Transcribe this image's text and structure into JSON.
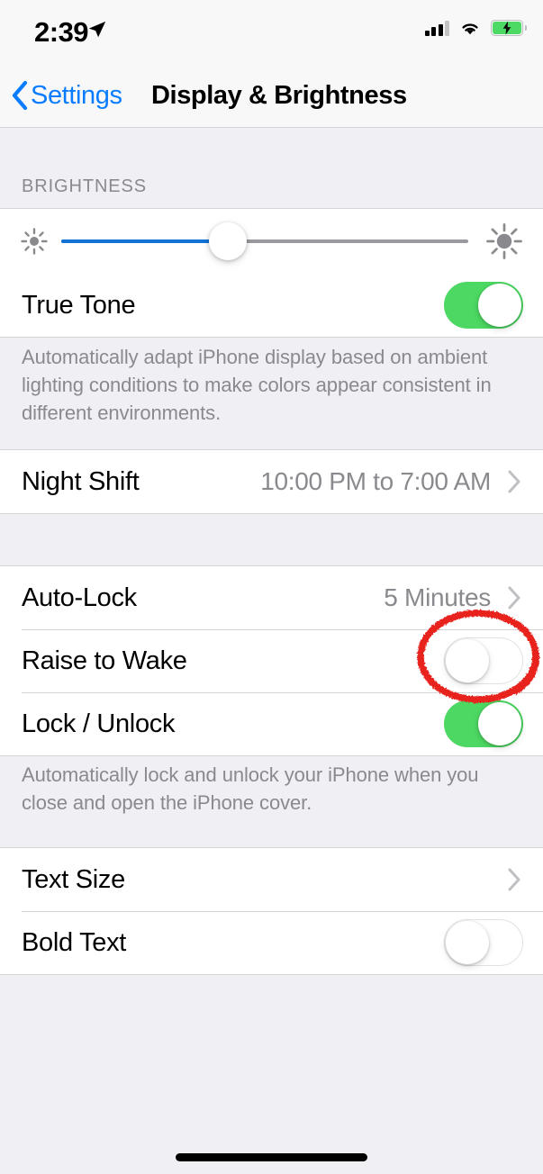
{
  "status_bar": {
    "time": "2:39",
    "location_icon": "location-arrow-icon",
    "signal_icon": "cellular-signal-icon",
    "signal_bars_filled": 3,
    "signal_bars_total": 4,
    "wifi_icon": "wifi-icon",
    "battery_icon": "battery-charging-icon",
    "battery_charging": true,
    "battery_color": "#4CD964"
  },
  "nav_bar": {
    "back_icon": "chevron-left-icon",
    "back_label": "Settings",
    "title": "Display & Brightness",
    "tint_color": "#0A7CFF"
  },
  "brightness": {
    "header": "BRIGHTNESS",
    "slider": {
      "name": "brightness-slider",
      "value_percent": 41,
      "min_icon": "sun-dim-icon",
      "max_icon": "sun-bright-icon",
      "fill_color": "#1272D6"
    },
    "true_tone": {
      "label": "True Tone",
      "toggle_state": "on",
      "toggle_color": "#4CD862"
    },
    "footnote": "Automatically adapt iPhone display based on ambient lighting conditions to make colors appear consistent in different environments."
  },
  "night_shift": {
    "label": "Night Shift",
    "value": "10:00 PM to 7:00 AM",
    "chevron_icon": "chevron-right-icon"
  },
  "lock_section": {
    "auto_lock": {
      "label": "Auto-Lock",
      "value": "5 Minutes",
      "chevron_icon": "chevron-right-icon"
    },
    "raise_to_wake": {
      "label": "Raise to Wake",
      "toggle_state": "off"
    },
    "lock_unlock": {
      "label": "Lock / Unlock",
      "toggle_state": "on",
      "toggle_color": "#4CD862"
    },
    "footnote": "Automatically lock and unlock your iPhone when you close and open the iPhone cover."
  },
  "text_section": {
    "text_size": {
      "label": "Text Size",
      "chevron_icon": "chevron-right-icon"
    },
    "bold_text": {
      "label": "Bold Text",
      "toggle_state": "off"
    }
  },
  "annotation": {
    "name": "red-circle-highlight",
    "target": "raise-to-wake-toggle",
    "color": "#E8211A"
  },
  "home_indicator": {
    "name": "home-indicator"
  }
}
